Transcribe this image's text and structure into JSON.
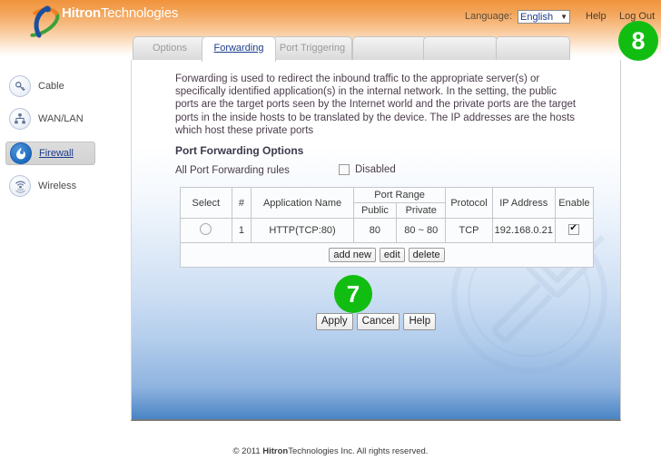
{
  "header": {
    "brand_bold": "Hitron",
    "brand_light": "Technologies",
    "language_label": "Language:",
    "language_value": "English",
    "language_arrow": "▼",
    "help": "Help",
    "logout": "Log Out"
  },
  "tabs": [
    {
      "label": "Options",
      "active": false
    },
    {
      "label": "Forwarding",
      "active": true
    },
    {
      "label": "Port Triggering",
      "active": false
    },
    {
      "label": "",
      "active": false
    },
    {
      "label": "",
      "active": false
    },
    {
      "label": "",
      "active": false
    }
  ],
  "sidebar": {
    "items": [
      {
        "label": "Cable",
        "icon": "key-icon",
        "selected": false
      },
      {
        "label": "WAN/LAN",
        "icon": "network-icon",
        "selected": false
      },
      {
        "label": "Firewall",
        "icon": "flame-icon",
        "selected": true
      },
      {
        "label": "Wireless",
        "icon": "wifi-signal-icon",
        "selected": false
      }
    ]
  },
  "main": {
    "description": "Forwarding is used to redirect the inbound traffic to the appropriate server(s) or specifically identified application(s) in the internal network. In the setting, the public ports are the target ports seen by the Internet world and the private ports are the target ports in the inside hosts to be translated by the device. The IP addresses are the hosts which host these private ports",
    "section_title": "Port Forwarding Options",
    "rules_label": "All Port Forwarding rules",
    "disabled_label": "Disabled",
    "disabled_checked": false,
    "table": {
      "headers": {
        "select": "Select",
        "number": "#",
        "application_name": "Application Name",
        "port_range": "Port Range",
        "public": "Public",
        "private": "Private",
        "protocol": "Protocol",
        "ip_address": "IP Address",
        "enable": "Enable"
      },
      "rows": [
        {
          "selected": false,
          "number": "1",
          "application_name": "HTTP(TCP:80)",
          "public": "80",
          "private": "80 ~ 80",
          "protocol": "TCP",
          "ip_address": "192.168.0.21",
          "enabled": true
        }
      ],
      "row_buttons": [
        "add new",
        "edit",
        "delete"
      ]
    },
    "action_buttons": [
      "Apply",
      "Cancel",
      "Help"
    ]
  },
  "badges": [
    {
      "id": "badge-7",
      "text": "7"
    },
    {
      "id": "badge-8",
      "text": "8"
    }
  ],
  "footer": {
    "copyright_prefix": "© 2011 ",
    "brand_bold": "Hitron",
    "brand_light": "Technologies",
    "suffix": " Inc.  All rights reserved."
  },
  "colors": {
    "header_orange": "#f0933c",
    "badge_green": "#12bd12",
    "link_blue": "#1a3c8c",
    "panel_blue": "#4a84c4"
  }
}
